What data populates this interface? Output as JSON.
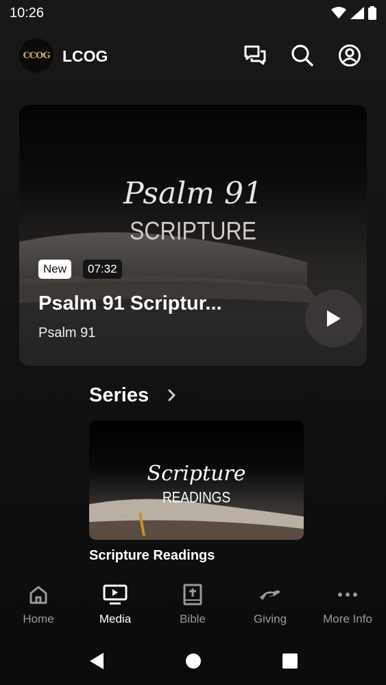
{
  "status": {
    "time": "10:26"
  },
  "header": {
    "logo_text": "CCOG",
    "app_title": "LCOG",
    "icons": [
      "chat-icon",
      "search-icon",
      "account-icon"
    ]
  },
  "hero": {
    "art_title": "Psalm 91",
    "art_subtitle": "SCRIPTURE",
    "badge_new": "New",
    "duration": "07:32",
    "title": "Psalm 91 Scriptur...",
    "series": "Psalm 91"
  },
  "series_section": {
    "title": "Series",
    "card": {
      "art_title": "Scripture",
      "art_subtitle": "READINGS",
      "caption": "Scripture Readings"
    }
  },
  "nav": {
    "active": "Media",
    "items": [
      {
        "label": "Home",
        "icon": "home-icon"
      },
      {
        "label": "Media",
        "icon": "media-icon"
      },
      {
        "label": "Bible",
        "icon": "bible-icon"
      },
      {
        "label": "Giving",
        "icon": "giving-icon"
      },
      {
        "label": "More Info",
        "icon": "more-icon"
      }
    ]
  },
  "colors": {
    "logo_gold": "#c9a758",
    "inactive_nav": "#9a9a9a",
    "active_nav": "#ffffff"
  }
}
